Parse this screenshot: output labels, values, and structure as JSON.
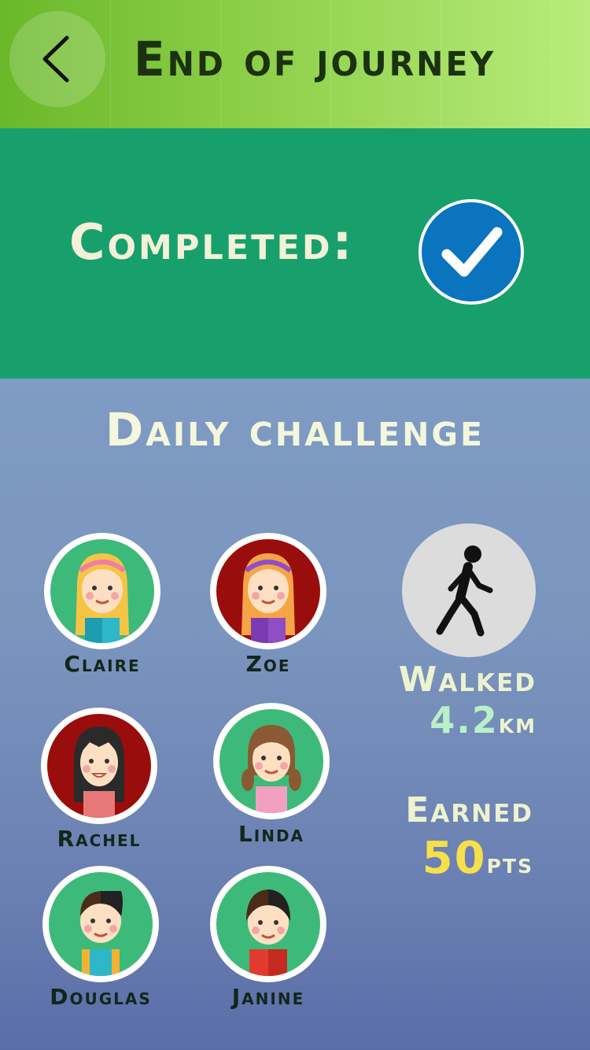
{
  "header": {
    "title": "End of journey",
    "back_icon": "chevron-left-icon"
  },
  "completion": {
    "label": "Completed:",
    "status_icon": "checkmark-icon",
    "status_color": "#0a74be"
  },
  "challenge": {
    "title": "Daily challenge",
    "friends": [
      {
        "name": "Claire",
        "bg": "#3dba7a"
      },
      {
        "name": "Zoe",
        "bg": "#9a0d0d"
      },
      {
        "name": "Rachel",
        "bg": "#9a0d0d"
      },
      {
        "name": "Linda",
        "bg": "#3dba7a"
      },
      {
        "name": "Douglas",
        "bg": "#3dba7a"
      },
      {
        "name": "Janine",
        "bg": "#3dba7a"
      }
    ],
    "activity_icon": "walking-person-icon",
    "walked_label": "Walked",
    "walked_value": "4.2",
    "walked_unit": "km",
    "earned_label": "Earned",
    "earned_value": "50",
    "earned_unit": "pts"
  },
  "colors": {
    "header_green": "#8fd04a",
    "completed_band": "#17a06b",
    "walked_value": "#b9f0c8",
    "earned_value": "#f6e04a"
  }
}
